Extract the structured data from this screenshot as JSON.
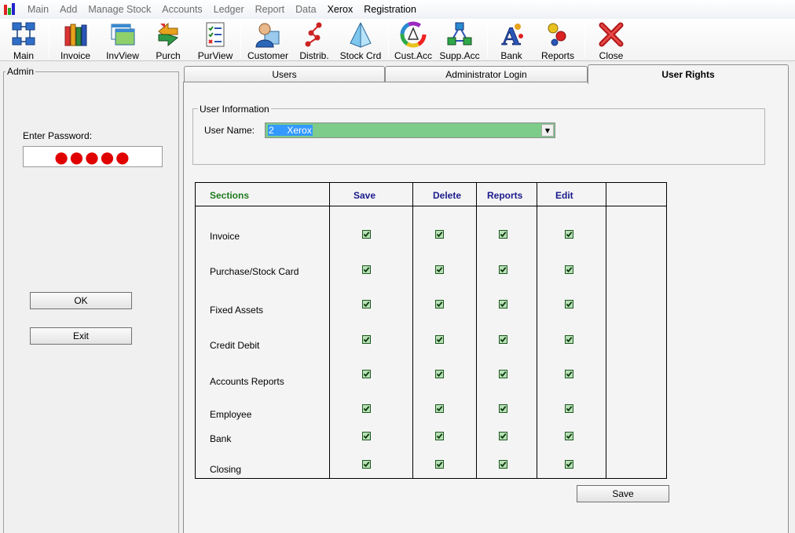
{
  "menu": {
    "items": [
      {
        "label": "Main",
        "active": false
      },
      {
        "label": "Add",
        "active": false
      },
      {
        "label": "Manage Stock",
        "active": false
      },
      {
        "label": "Accounts",
        "active": false
      },
      {
        "label": "Ledger",
        "active": false
      },
      {
        "label": "Report",
        "active": false
      },
      {
        "label": "Data",
        "active": false
      },
      {
        "label": "Xerox",
        "active": true
      },
      {
        "label": "Registration",
        "active": true
      }
    ]
  },
  "toolbar": {
    "main": "Main",
    "invoice": "Invoice",
    "invview": "InvView",
    "purch": "Purch",
    "purview": "PurView",
    "customer": "Customer",
    "distrib": "Distrib.",
    "stockcrd": "Stock Crd",
    "custacc": "Cust.Acc",
    "suppacc": "Supp.Acc",
    "bank": "Bank",
    "reports": "Reports",
    "close": "Close"
  },
  "admin": {
    "legend": "Admin",
    "password_label": "Enter Password:",
    "password_mask": "●●●●●",
    "ok_label": "OK",
    "exit_label": "Exit"
  },
  "tabs": {
    "users": "Users",
    "admin_login": "Administrator Login",
    "user_rights": "User Rights"
  },
  "user_info": {
    "legend": "User Information",
    "username_label": "User Name:",
    "username_value": "2     Xerox"
  },
  "rights": {
    "headers": {
      "sections": "Sections",
      "save": "Save",
      "delete": "Delete",
      "reports": "Reports",
      "edit": "Edit"
    },
    "rows": [
      {
        "section": "Invoice",
        "save": true,
        "delete": true,
        "reports": true,
        "edit": true
      },
      {
        "section": "Purchase/Stock Card",
        "save": true,
        "delete": true,
        "reports": true,
        "edit": true
      },
      {
        "section": "Fixed Assets",
        "save": true,
        "delete": true,
        "reports": true,
        "edit": true
      },
      {
        "section": "Credit Debit",
        "save": true,
        "delete": true,
        "reports": true,
        "edit": true
      },
      {
        "section": "Accounts Reports",
        "save": true,
        "delete": true,
        "reports": true,
        "edit": true
      },
      {
        "section": "Employee",
        "save": true,
        "delete": true,
        "reports": true,
        "edit": true
      },
      {
        "section": "Bank",
        "save": true,
        "delete": true,
        "reports": true,
        "edit": true
      },
      {
        "section": "Closing",
        "save": true,
        "delete": true,
        "reports": true,
        "edit": true
      }
    ],
    "save_button": "Save"
  }
}
